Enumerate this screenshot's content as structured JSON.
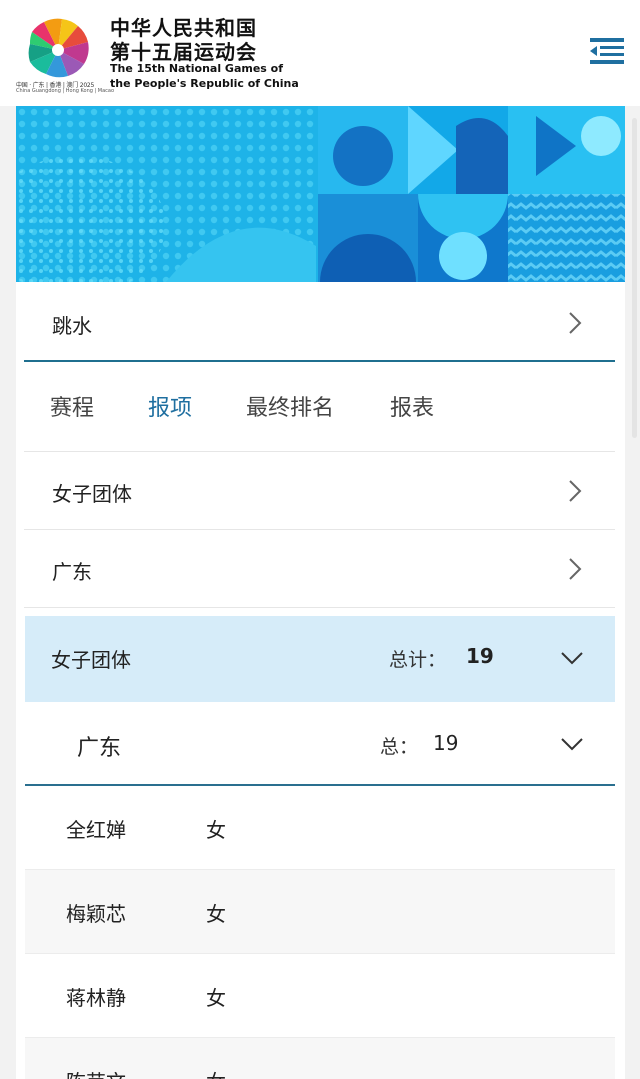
{
  "header": {
    "logo_caption": "中国 · 广东 | 香港 | 澳门 2025",
    "logo_caption_en": "China Guangdong | Hong Kong | Macao",
    "title_line1": "中华人民共和国",
    "title_line2": "第十五届运动会",
    "title_en_line1": "The 15th National Games of",
    "title_en_line2": "the People's Republic of China",
    "menu_icon": "menu-icon"
  },
  "sport": {
    "label": "跳水"
  },
  "tabs": [
    {
      "label": "赛程",
      "active": false
    },
    {
      "label": "报项",
      "active": true
    },
    {
      "label": "最终排名",
      "active": false
    },
    {
      "label": "报表",
      "active": false
    }
  ],
  "filters": [
    {
      "label": "女子团体"
    },
    {
      "label": "广东"
    }
  ],
  "group": {
    "label": "女子团体",
    "total_label": "总计：",
    "total_value": "19"
  },
  "subgroup": {
    "label": "广东",
    "total_label": "总：",
    "total_value": "19"
  },
  "athletes": [
    {
      "name": "全红婵",
      "gender": "女"
    },
    {
      "name": "梅颖芯",
      "gender": "女"
    },
    {
      "name": "蒋林静",
      "gender": "女"
    },
    {
      "name": "陈芋文",
      "gender": "女"
    }
  ],
  "colors": {
    "accent": "#1f6fa0",
    "banner": "#1ab6ea",
    "group_header_bg": "#d6ecf9"
  }
}
